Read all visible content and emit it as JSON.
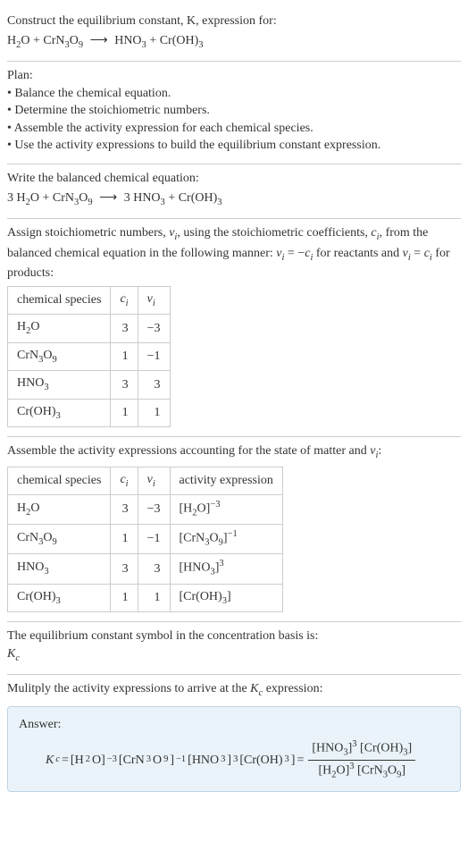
{
  "intro": {
    "line1": "Construct the equilibrium constant, K, expression for:",
    "eq_lhs1": "H",
    "eq_lhs1_sub": "2",
    "eq_lhs1b": "O + CrN",
    "eq_lhs1b_sub": "3",
    "eq_lhs1c": "O",
    "eq_lhs1c_sub": "9",
    "arrow": "⟶",
    "eq_rhs1": "HNO",
    "eq_rhs1_sub": "3",
    "eq_rhs1b": " + Cr(OH)",
    "eq_rhs1b_sub": "3"
  },
  "plan": {
    "title": "Plan:",
    "b1": "• Balance the chemical equation.",
    "b2": "• Determine the stoichiometric numbers.",
    "b3": "• Assemble the activity expression for each chemical species.",
    "b4": "• Use the activity expressions to build the equilibrium constant expression."
  },
  "balanced": {
    "title": "Write the balanced chemical equation:",
    "pre": "3 H",
    "pre_sub": "2",
    "preb": "O + CrN",
    "preb_sub": "3",
    "prec": "O",
    "prec_sub": "9",
    "arrow": "⟶",
    "post": "3 HNO",
    "post_sub": "3",
    "postb": " + Cr(OH)",
    "postb_sub": "3"
  },
  "stoich_text": {
    "t1": "Assign stoichiometric numbers, ",
    "nu": "ν",
    "nu_sub": "i",
    "t2": ", using the stoichiometric coefficients, ",
    "c": "c",
    "c_sub": "i",
    "t3": ", from the balanced chemical equation in the following manner: ",
    "rel1a": "ν",
    "rel1a_sub": "i",
    "rel1_eq": " = −",
    "rel1b": "c",
    "rel1b_sub": "i",
    "t4": " for reactants and ",
    "rel2a": "ν",
    "rel2a_sub": "i",
    "rel2_eq": " = ",
    "rel2b": "c",
    "rel2b_sub": "i",
    "t5": " for products:"
  },
  "table1": {
    "headers": {
      "h1": "chemical species",
      "h2": "c",
      "h2_sub": "i",
      "h3": "ν",
      "h3_sub": "i"
    },
    "rows": [
      {
        "sp": "H",
        "sp_sub": "2",
        "sp2": "O",
        "c": "3",
        "n": "−3"
      },
      {
        "sp": "CrN",
        "sp_sub": "3",
        "sp2": "O",
        "sp2_sub": "9",
        "c": "1",
        "n": "−1"
      },
      {
        "sp": "HNO",
        "sp_sub": "3",
        "sp2": "",
        "c": "3",
        "n": "3"
      },
      {
        "sp": "Cr(OH)",
        "sp_sub": "3",
        "sp2": "",
        "c": "1",
        "n": "1"
      }
    ]
  },
  "assemble_text": {
    "t1": "Assemble the activity expressions accounting for the state of matter and ",
    "nu": "ν",
    "nu_sub": "i",
    "t2": ":"
  },
  "table2": {
    "headers": {
      "h1": "chemical species",
      "h2": "c",
      "h2_sub": "i",
      "h3": "ν",
      "h3_sub": "i",
      "h4": "activity expression"
    },
    "rows": [
      {
        "sp": "H",
        "sp_sub": "2",
        "sp2": "O",
        "c": "3",
        "n": "−3",
        "act": "[H",
        "act_sub": "2",
        "act2": "O]",
        "act_sup": "−3"
      },
      {
        "sp": "CrN",
        "sp_sub": "3",
        "sp2": "O",
        "sp2_sub": "9",
        "c": "1",
        "n": "−1",
        "act": "[CrN",
        "act_sub": "3",
        "act2": "O",
        "act2_sub": "9",
        "act3": "]",
        "act_sup": "−1"
      },
      {
        "sp": "HNO",
        "sp_sub": "3",
        "sp2": "",
        "c": "3",
        "n": "3",
        "act": "[HNO",
        "act_sub": "3",
        "act2": "]",
        "act_sup": "3"
      },
      {
        "sp": "Cr(OH)",
        "sp_sub": "3",
        "sp2": "",
        "c": "1",
        "n": "1",
        "act": "[Cr(OH)",
        "act_sub": "3",
        "act2": "]",
        "act_sup": ""
      }
    ]
  },
  "kc_symbol": {
    "t1": "The equilibrium constant symbol in the concentration basis is:",
    "k": "K",
    "k_sub": "c"
  },
  "multiply": {
    "t1": "Mulitply the activity expressions to arrive at the ",
    "k": "K",
    "k_sub": "c",
    "t2": " expression:"
  },
  "answer": {
    "label": "Answer:",
    "lhs_k": "K",
    "lhs_k_sub": "c",
    "eq": " = ",
    "e1": "[H",
    "e1_sub": "2",
    "e1b": "O]",
    "e1_sup": "−3",
    "e2": " [CrN",
    "e2_sub": "3",
    "e2b": "O",
    "e2b_sub": "9",
    "e2c": "]",
    "e2_sup": "−1",
    "e3": " [HNO",
    "e3_sub": "3",
    "e3b": "]",
    "e3_sup": "3",
    "e4": " [Cr(OH)",
    "e4_sub": "3",
    "e4b": "]",
    "eq2": " = ",
    "top1": "[HNO",
    "top1_sub": "3",
    "top1b": "]",
    "top1_sup": "3",
    "top2": " [Cr(OH)",
    "top2_sub": "3",
    "top2b": "]",
    "bot1": "[H",
    "bot1_sub": "2",
    "bot1b": "O]",
    "bot1_sup": "3",
    "bot2": " [CrN",
    "bot2_sub": "3",
    "bot2b": "O",
    "bot2b_sub": "9",
    "bot2c": "]"
  }
}
